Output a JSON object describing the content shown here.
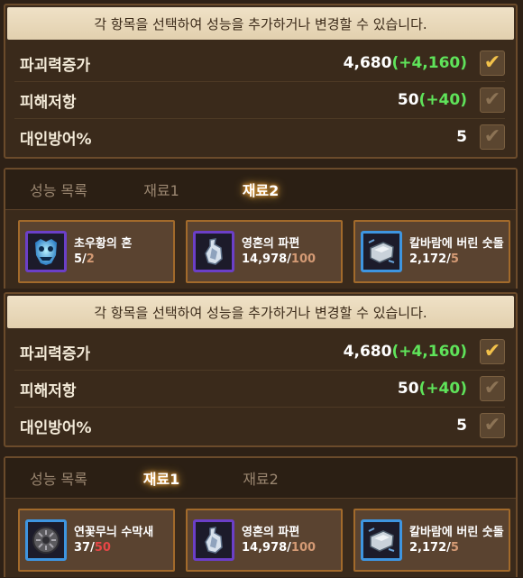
{
  "screens": [
    {
      "hint": "각 항목을 선택하여 성능을 추가하거나 변경할 수 있습니다.",
      "options": [
        {
          "name": "파괴력증가",
          "value": "4,680",
          "bonus": "(+4,160)",
          "checked": true
        },
        {
          "name": "피해저항",
          "value": "50",
          "bonus": "(+40)",
          "checked": false
        },
        {
          "name": "대인방어%",
          "value": "5",
          "bonus": "",
          "checked": false
        }
      ],
      "tabs": [
        "성능 목록",
        "재료1",
        "재료2"
      ],
      "active_tab": "재료2",
      "materials": [
        {
          "name": "초우황의 혼",
          "have": "5",
          "need": "2",
          "icon": "ghost-mask-icon"
        },
        {
          "name": "영혼의 파편",
          "have": "14,978",
          "need": "100",
          "icon": "soul-fragment-icon"
        },
        {
          "name": "칼바람에 버린 숫돌",
          "have": "2,172",
          "need": "5",
          "icon": "whetstone-icon"
        }
      ]
    },
    {
      "hint": "각 항목을 선택하여 성능을 추가하거나 변경할 수 있습니다.",
      "options": [
        {
          "name": "파괴력증가",
          "value": "4,680",
          "bonus": "(+4,160)",
          "checked": true
        },
        {
          "name": "피해저항",
          "value": "50",
          "bonus": "(+40)",
          "checked": false
        },
        {
          "name": "대인방어%",
          "value": "5",
          "bonus": "",
          "checked": false
        }
      ],
      "tabs": [
        "성능 목록",
        "재료1",
        "재료2"
      ],
      "active_tab": "재료1",
      "materials": [
        {
          "name": "연꽃무늬 수막새",
          "have": "37",
          "need": "50",
          "icon": "lotus-tile-icon"
        },
        {
          "name": "영혼의 파편",
          "have": "14,978",
          "need": "100",
          "icon": "soul-fragment-icon"
        },
        {
          "name": "칼바람에 버린 숫돌",
          "have": "2,172",
          "need": "5",
          "icon": "whetstone-icon"
        }
      ]
    }
  ],
  "colors": {
    "bonus": "#5fe35a",
    "insufficient": "#e64646",
    "sufficient": "#d49a74",
    "active_tab_glow": "#ffbf4a"
  }
}
